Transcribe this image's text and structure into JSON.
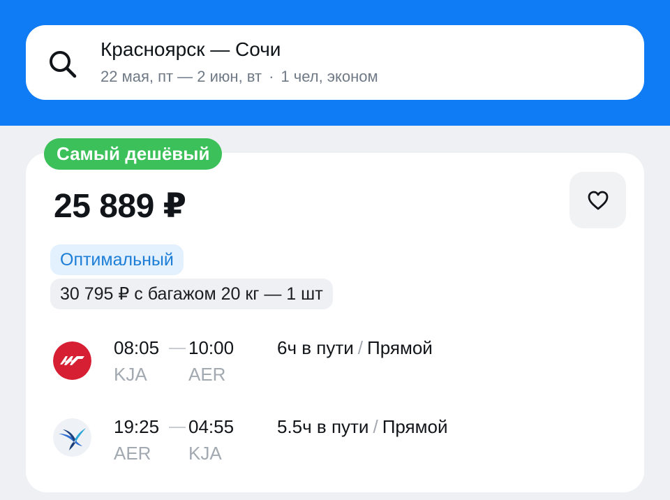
{
  "search": {
    "icon": "search-icon",
    "route": "Красноярск — Сочи",
    "dates": "22 мая, пт — 2 июн, вт",
    "separator": "·",
    "passengers": "1 чел, эконом"
  },
  "offer": {
    "badge": "Самый дешёвый",
    "price": "25 889 ₽",
    "favorite_icon": "heart-icon",
    "tag_optimal": "Оптимальный",
    "tag_baggage": "30 795 ₽ с багажом 20 кг — 1 шт",
    "segments": [
      {
        "airline_icon": "nordwind-logo-icon",
        "depart_time": "08:05",
        "arrive_time": "10:00",
        "depart_code": "KJA",
        "arrive_code": "AER",
        "duration": "6ч в пути",
        "slash": "/",
        "type": "Прямой"
      },
      {
        "airline_icon": "bird-logo-icon",
        "depart_time": "19:25",
        "arrive_time": "04:55",
        "depart_code": "AER",
        "arrive_code": "KJA",
        "duration": "5.5ч в пути",
        "slash": "/",
        "type": "Прямой"
      }
    ]
  },
  "colors": {
    "header": "#0f7bf4",
    "badge": "#3cc05a",
    "accent_blue": "#1c7ed6",
    "muted": "#a2a9b1"
  }
}
